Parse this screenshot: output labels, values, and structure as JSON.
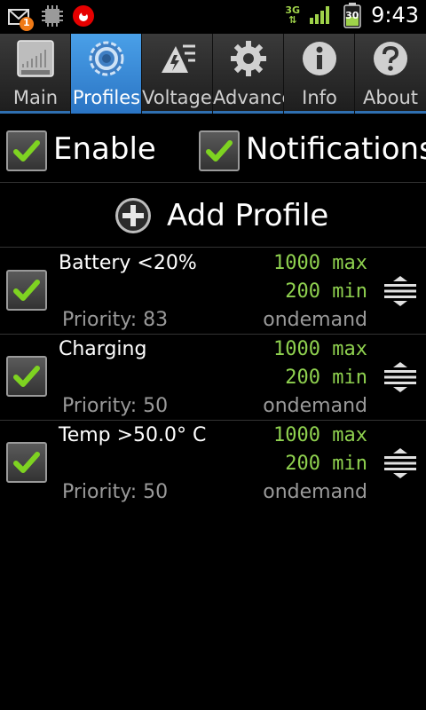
{
  "status_bar": {
    "time": "9:43",
    "network": "3G",
    "battery_level": "30",
    "notification_count": "1",
    "icons": [
      "missed-message-icon",
      "chip-icon",
      "vodafone-icon",
      "signal-icon",
      "battery-icon"
    ]
  },
  "tabs": [
    {
      "label": "Main",
      "icon": "setcpu-chip-icon",
      "active": false
    },
    {
      "label": "Profiles",
      "icon": "profiles-gear-icon",
      "active": true
    },
    {
      "label": "Voltages",
      "icon": "voltages-icon",
      "active": false
    },
    {
      "label": "Advanced",
      "icon": "gear-icon",
      "active": false
    },
    {
      "label": "Info",
      "icon": "info-icon",
      "active": false
    },
    {
      "label": "About",
      "icon": "help-icon",
      "active": false
    }
  ],
  "toggles": {
    "enable_label": "Enable",
    "enable_checked": true,
    "notifications_label": "Notifications",
    "notifications_checked": true
  },
  "add_profile": {
    "label": "Add Profile"
  },
  "profiles": [
    {
      "name": "Battery <20%",
      "priority": "Priority: 83",
      "max": "1000 max",
      "min": "200 min",
      "governor": "ondemand",
      "checked": true
    },
    {
      "name": "Charging",
      "priority": "Priority: 50",
      "max": "1000 max",
      "min": "200 min",
      "governor": "ondemand",
      "checked": true
    },
    {
      "name": "Temp >50.0° C",
      "priority": "Priority: 50",
      "max": "1000 max",
      "min": "200 min",
      "governor": "ondemand",
      "checked": true
    }
  ],
  "colors": {
    "accent": "#2a74c4",
    "freq_green": "#8fd14f",
    "check_green": "#7ed321"
  }
}
